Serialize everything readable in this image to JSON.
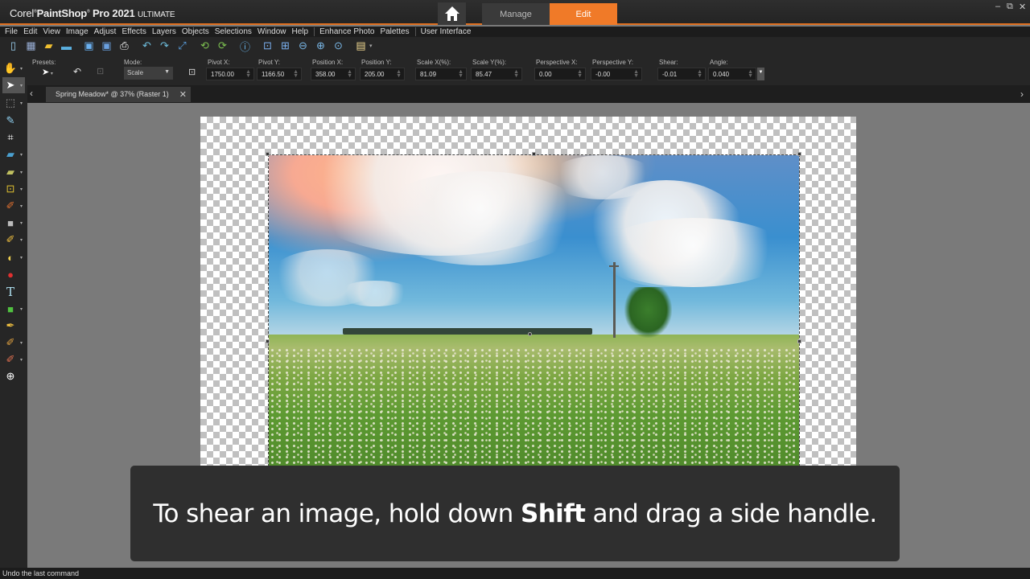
{
  "app": {
    "title_prefix": "Corel",
    "title_main": "PaintShop",
    "title_pro": "Pro 2021",
    "title_edition": "ULTIMATE"
  },
  "workspace_tabs": [
    {
      "label": "Manage",
      "active": false
    },
    {
      "label": "Edit",
      "active": true
    }
  ],
  "window_controls": {
    "minimize": "–",
    "restore": "⧉",
    "close": "✕"
  },
  "menu": [
    "File",
    "Edit",
    "View",
    "Image",
    "Adjust",
    "Effects",
    "Layers",
    "Objects",
    "Selections",
    "Window",
    "Help"
  ],
  "menu_extra": [
    "Enhance Photo",
    "Palettes"
  ],
  "menu_ui": "User Interface",
  "toolbar": [
    {
      "name": "new-file-icon",
      "glyph": "▯",
      "color": "#9ad0f0"
    },
    {
      "name": "new-from-template-icon",
      "glyph": "▦",
      "color": "#9ab0d8"
    },
    {
      "name": "open-folder-icon",
      "glyph": "▰",
      "color": "#f0c030"
    },
    {
      "name": "scan-icon",
      "glyph": "▬",
      "color": "#5ab0e0"
    },
    {
      "name": "save-icon",
      "glyph": "▣",
      "color": "#6ab0f0"
    },
    {
      "name": "save-as-icon",
      "glyph": "▣",
      "color": "#6aa0e0"
    },
    {
      "name": "print-icon",
      "glyph": "⎙",
      "color": "#ffffff"
    },
    {
      "name": "undo-icon",
      "glyph": "↶",
      "color": "#6fc0e0"
    },
    {
      "name": "redo-icon",
      "glyph": "↷",
      "color": "#6fc0e0"
    },
    {
      "name": "resize-icon",
      "glyph": "⤢",
      "color": "#5aa0e0"
    },
    {
      "name": "rotate-left-icon",
      "glyph": "⟲",
      "color": "#7cc050"
    },
    {
      "name": "rotate-right-icon",
      "glyph": "⟳",
      "color": "#7cc050"
    },
    {
      "name": "image-info-icon",
      "glyph": "ⓘ",
      "color": "#6ab8f0"
    },
    {
      "name": "actual-size-icon",
      "glyph": "⊡",
      "color": "#7ab0f0"
    },
    {
      "name": "fit-window-icon",
      "glyph": "⊞",
      "color": "#7ab0f0"
    },
    {
      "name": "zoom-out-icon",
      "glyph": "⊖",
      "color": "#7ab8e8"
    },
    {
      "name": "zoom-in-icon",
      "glyph": "⊕",
      "color": "#7ab8e8"
    },
    {
      "name": "zoom-fit-icon",
      "glyph": "⊙",
      "color": "#7ab8e8"
    },
    {
      "name": "paste-icon",
      "glyph": "▤",
      "color": "#f0d890"
    }
  ],
  "options": {
    "presets_label": "Presets:",
    "mode_label": "Mode:",
    "mode_value": "Scale",
    "fields": [
      {
        "label": "Pivot X:",
        "value": "1750.00"
      },
      {
        "label": "Pivot Y:",
        "value": "1166.50"
      },
      {
        "label": "Position X:",
        "value": "358.00"
      },
      {
        "label": "Position Y:",
        "value": "205.00"
      },
      {
        "label": "Scale X(%):",
        "value": "81.09"
      },
      {
        "label": "Scale Y(%):",
        "value": "85.47"
      },
      {
        "label": "Perspective X:",
        "value": "0.00"
      },
      {
        "label": "Perspective Y:",
        "value": "-0.00"
      },
      {
        "label": "Shear:",
        "value": "-0.01"
      },
      {
        "label": "Angle:",
        "value": "0.040"
      }
    ]
  },
  "tools": [
    {
      "name": "pan-tool-icon",
      "glyph": "✋",
      "color": "#f0b040",
      "dropdown": true
    },
    {
      "name": "pick-tool-icon",
      "glyph": "➤",
      "color": "#ffffff",
      "dropdown": true,
      "active": true
    },
    {
      "name": "selection-tool-icon",
      "glyph": "⬚",
      "color": "#aaaaaa",
      "dropdown": true
    },
    {
      "name": "dropper-tool-icon",
      "glyph": "✎",
      "color": "#8fd0f0",
      "dropdown": false
    },
    {
      "name": "crop-tool-icon",
      "glyph": "⌗",
      "color": "#ffffff",
      "dropdown": false
    },
    {
      "name": "red-eye-tool-icon",
      "glyph": "▰",
      "color": "#4aa0d0",
      "dropdown": true
    },
    {
      "name": "makeover-tool-icon",
      "glyph": "▰",
      "color": "#c0c060",
      "dropdown": true
    },
    {
      "name": "clone-tool-icon",
      "glyph": "⊡",
      "color": "#e0c030",
      "dropdown": true
    },
    {
      "name": "paint-brush-icon",
      "glyph": "✐",
      "color": "#e07030",
      "dropdown": true
    },
    {
      "name": "gradient-tool-icon",
      "glyph": "■",
      "color": "#bbbbbb",
      "dropdown": true
    },
    {
      "name": "eraser-tool-icon",
      "glyph": "✐",
      "color": "#f0c040",
      "dropdown": true
    },
    {
      "name": "retouch-tool-icon",
      "glyph": "◐",
      "color": "#f0d050",
      "dropdown": true
    },
    {
      "name": "fill-tool-icon",
      "glyph": "●",
      "color": "#e03030",
      "dropdown": false
    },
    {
      "name": "text-tool-icon",
      "glyph": "T",
      "color": "#aee0f0",
      "dropdown": false
    },
    {
      "name": "shape-tool-icon",
      "glyph": "■",
      "color": "#50c040",
      "dropdown": true
    },
    {
      "name": "pen-tool-icon",
      "glyph": "✒",
      "color": "#f0c040",
      "dropdown": false
    },
    {
      "name": "warp-brush-icon",
      "glyph": "✐",
      "color": "#e0a040",
      "dropdown": true
    },
    {
      "name": "art-media-icon",
      "glyph": "✐",
      "color": "#e07050",
      "dropdown": true
    },
    {
      "name": "add-tool-icon",
      "glyph": "⊕",
      "color": "#ffffff",
      "dropdown": false
    }
  ],
  "document_tab": {
    "label": "Spring Meadow* @  37% (Raster 1)",
    "close": "✕"
  },
  "caption": {
    "before": "To shear an image, hold down ",
    "bold": "Shift",
    "after": " and drag a side handle."
  },
  "status": "Undo the last command",
  "colors": {
    "accent": "#f07a28"
  }
}
